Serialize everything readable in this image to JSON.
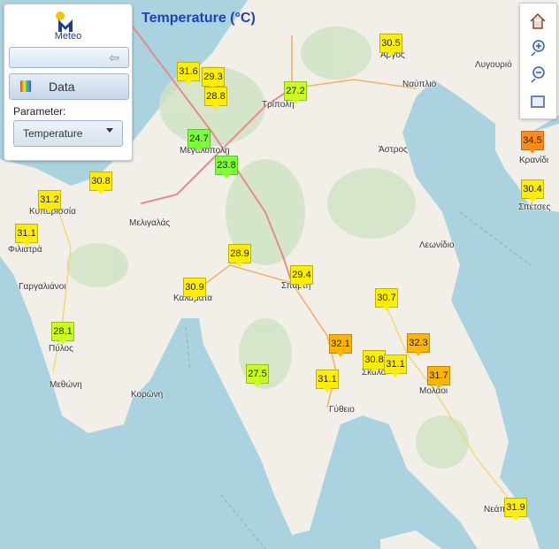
{
  "app": {
    "logo_text": "Meteo",
    "title": "Temperature (°C)"
  },
  "panel": {
    "data_label": "Data",
    "parameter_label": "Parameter:",
    "parameter_value": "Temperature"
  },
  "colors": {
    "sea": "#aad3df",
    "land": "#f2efe9",
    "brand_blue": "#1f3fbf",
    "marker_green": "#7cff3a",
    "marker_yellowgreen": "#c8ff1e",
    "marker_yellow": "#ffee00",
    "marker_orange": "#ffb400",
    "marker_darkorange": "#ff8c1a"
  },
  "toolbar": [
    {
      "name": "home-icon",
      "glyph": "⌂"
    },
    {
      "name": "zoom-in-icon",
      "glyph": "+"
    },
    {
      "name": "zoom-out-icon",
      "glyph": "−"
    },
    {
      "name": "zoom-extent-icon",
      "glyph": "▢"
    }
  ],
  "places": [
    {
      "label": "Άργος"
    },
    {
      "label": "Λυγουριό"
    },
    {
      "label": "Ναύπλιο"
    },
    {
      "label": "Τρίπολη"
    },
    {
      "label": "Μεγαλόπολη"
    },
    {
      "label": "Άστρος"
    },
    {
      "label": "Κρανίδι"
    },
    {
      "label": "Σπέτσες"
    },
    {
      "label": "Κυπαρισσία"
    },
    {
      "label": "Μελιγαλάς"
    },
    {
      "label": "Φιλιατρά"
    },
    {
      "label": "Λεωνίδιο"
    },
    {
      "label": "Γαργαλιάνοι"
    },
    {
      "label": "Καλαμάτα"
    },
    {
      "label": "Σπάρτη"
    },
    {
      "label": "Πύλος"
    },
    {
      "label": "Σκάλα"
    },
    {
      "label": "Μολάοι"
    },
    {
      "label": "Μεθώνη"
    },
    {
      "label": "Κορώνη"
    },
    {
      "label": "Γύθειο"
    },
    {
      "label": "Νεάπολη"
    }
  ],
  "stations": [
    {
      "value": "31.6",
      "color": "#ffee00"
    },
    {
      "value": "29.3",
      "color": "#ffee00"
    },
    {
      "value": "28.8",
      "color": "#ffee00"
    },
    {
      "value": "24.7",
      "color": "#7cff3a"
    },
    {
      "value": "23.8",
      "color": "#7cff3a"
    },
    {
      "value": "27.2",
      "color": "#c8ff1e"
    },
    {
      "value": "30.5",
      "color": "#ffee00"
    },
    {
      "value": "34.5",
      "color": "#ff8c1a"
    },
    {
      "value": "30.4",
      "color": "#ffee00"
    },
    {
      "value": "30.8",
      "color": "#ffee00"
    },
    {
      "value": "31.2",
      "color": "#ffee00"
    },
    {
      "value": "31.1",
      "color": "#ffee00"
    },
    {
      "value": "28.9",
      "color": "#ffee00"
    },
    {
      "value": "30.9",
      "color": "#ffee00"
    },
    {
      "value": "29.4",
      "color": "#ffee00"
    },
    {
      "value": "30.7",
      "color": "#ffee00"
    },
    {
      "value": "28.1",
      "color": "#c8ff1e"
    },
    {
      "value": "32.1",
      "color": "#ffb400"
    },
    {
      "value": "32.3",
      "color": "#ffb400"
    },
    {
      "value": "30.8",
      "color": "#ffee00"
    },
    {
      "value": "31.1",
      "color": "#ffee00"
    },
    {
      "value": "31.7",
      "color": "#ffb400"
    },
    {
      "value": "27.5",
      "color": "#c8ff1e"
    },
    {
      "value": "31.1",
      "color": "#ffee00"
    },
    {
      "value": "31.9",
      "color": "#ffee00"
    }
  ]
}
